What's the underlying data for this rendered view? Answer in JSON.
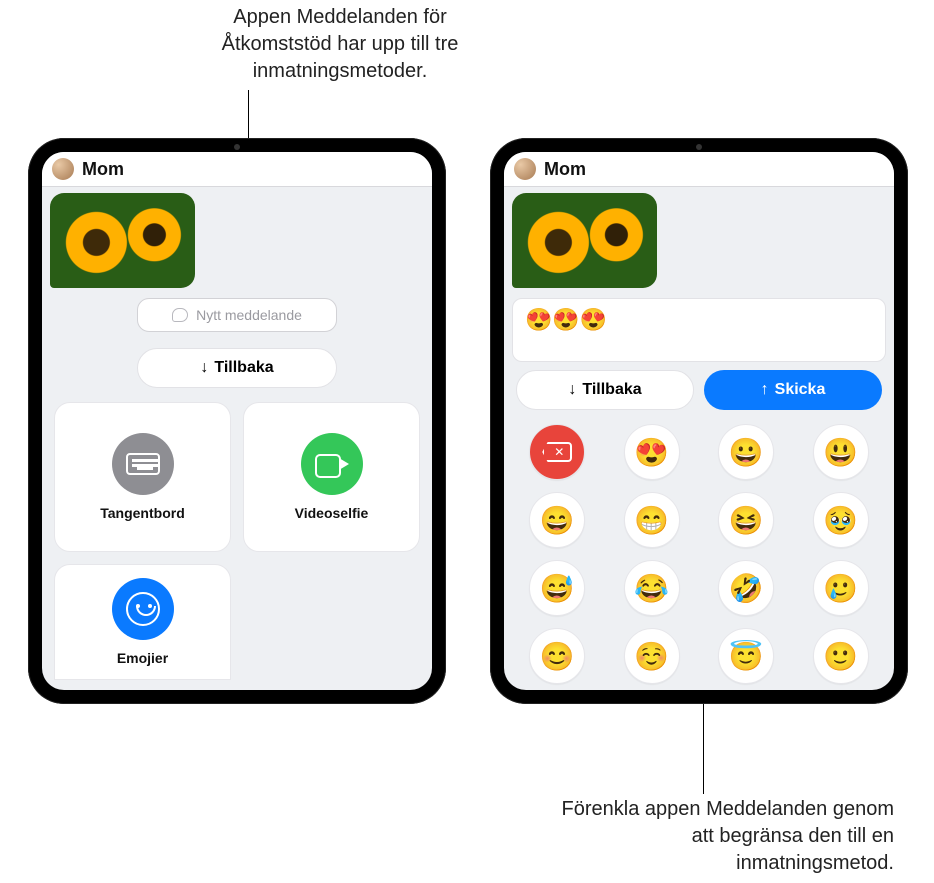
{
  "callouts": {
    "top": "Appen Meddelanden för Åtkomststöd har upp till tre inmatningsmetoder.",
    "bottom": "Förenkla appen Meddelanden genom att begränsa den till en inmatningsmetod."
  },
  "contact_name": "Mom",
  "left": {
    "compose_placeholder": "Nytt meddelande",
    "back_label": "Tillbaka",
    "options": {
      "keyboard": "Tangentbord",
      "videoselfie": "Videoselfie",
      "emoji": "Emojier"
    }
  },
  "right": {
    "compose_value": "😍😍😍",
    "back_label": "Tillbaka",
    "send_label": "Skicka",
    "emoji_keys": [
      "😍",
      "😀",
      "😃",
      "😄",
      "😁",
      "😆",
      "🥹",
      "😅",
      "😂",
      "🤣",
      "🥲",
      "😊",
      "☺️",
      "😇",
      "🙂"
    ]
  }
}
